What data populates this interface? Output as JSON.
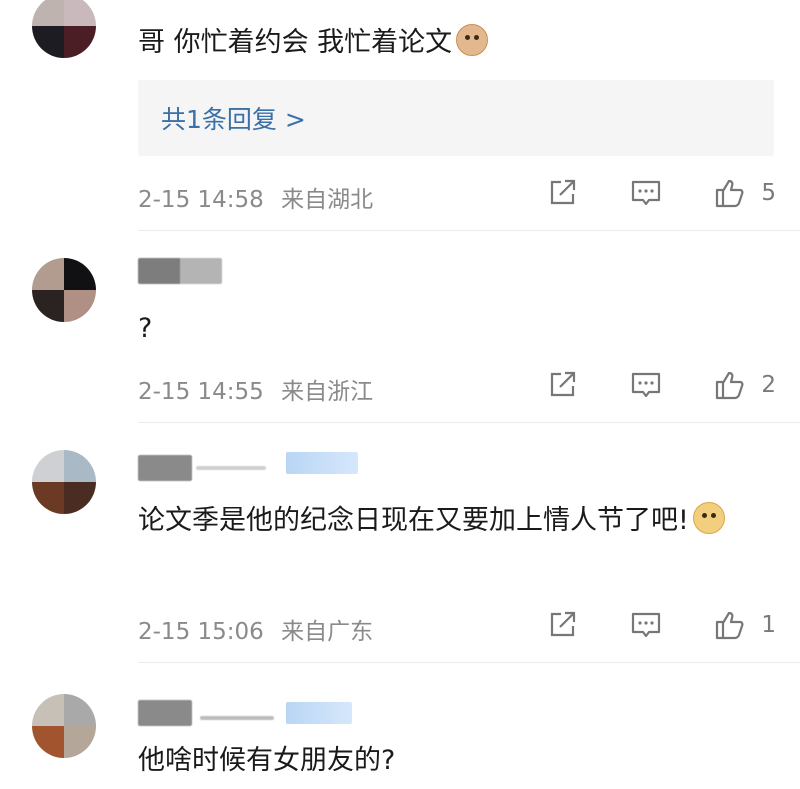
{
  "comments": [
    {
      "text": "哥 你忙着约会 我忙着论文",
      "emoji": "bear-face-emoji",
      "reply_link": "共1条回复 >",
      "time": "2-15 14:58",
      "location": "来自湖北",
      "likes": "5"
    },
    {
      "text": "?",
      "time": "2-15 14:55",
      "location": "来自浙江",
      "likes": "2"
    },
    {
      "text": "论文季是他的纪念日现在又要加上情人节了吧!",
      "emoji": "doge-face-emoji",
      "time": "2-15 15:06",
      "location": "来自广东",
      "likes": "1"
    },
    {
      "text": "他啥时候有女朋友的?"
    }
  ],
  "icons": {
    "share": "share-icon",
    "comment": "comment-icon",
    "like": "thumbs-up-icon"
  },
  "colors": {
    "link": "#3b6fa8",
    "meta": "#8a8a8a",
    "reply_bg": "#f5f5f5",
    "badge": "#b9d6f5"
  }
}
